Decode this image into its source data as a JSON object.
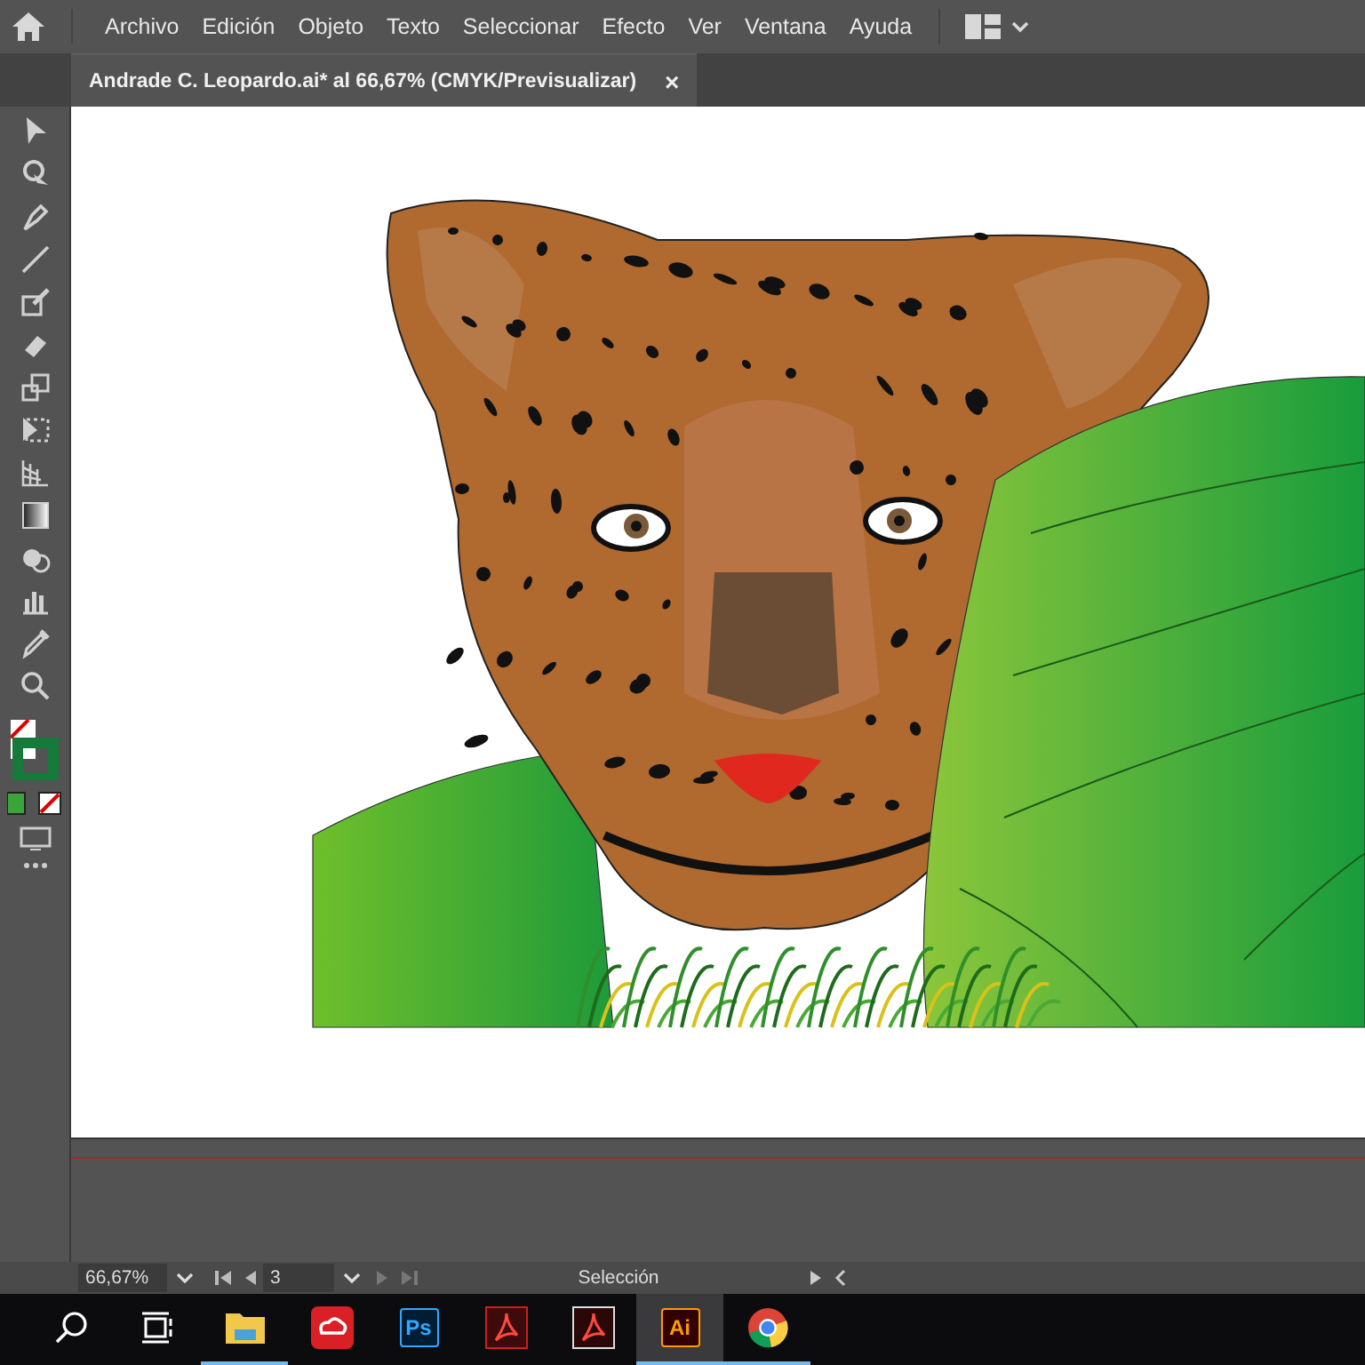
{
  "menu_bar": {
    "items": [
      "Archivo",
      "Edición",
      "Objeto",
      "Texto",
      "Seleccionar",
      "Efecto",
      "Ver",
      "Ventana",
      "Ayuda"
    ]
  },
  "document_tab": {
    "title": "Andrade C. Leopardo.ai* al 66,67% (CMYK/Previsualizar)",
    "close": "×"
  },
  "status_bar": {
    "zoom": "66,67%",
    "artboard": "3",
    "tool": "Selección"
  },
  "taskbar": {
    "apps": [
      {
        "kind": "search",
        "selected": false,
        "running": false
      },
      {
        "kind": "taskview",
        "selected": false,
        "running": false
      },
      {
        "kind": "folder",
        "selected": false,
        "running": true
      },
      {
        "kind": "creative-cloud",
        "selected": false,
        "running": false
      },
      {
        "kind": "photoshop",
        "label": "Ps",
        "selected": false,
        "running": false
      },
      {
        "kind": "acrobat",
        "selected": false,
        "running": false
      },
      {
        "kind": "acrobat-reader",
        "selected": false,
        "running": false
      },
      {
        "kind": "illustrator",
        "label": "Ai",
        "selected": true,
        "running": true
      },
      {
        "kind": "chrome",
        "selected": false,
        "running": true
      }
    ]
  }
}
